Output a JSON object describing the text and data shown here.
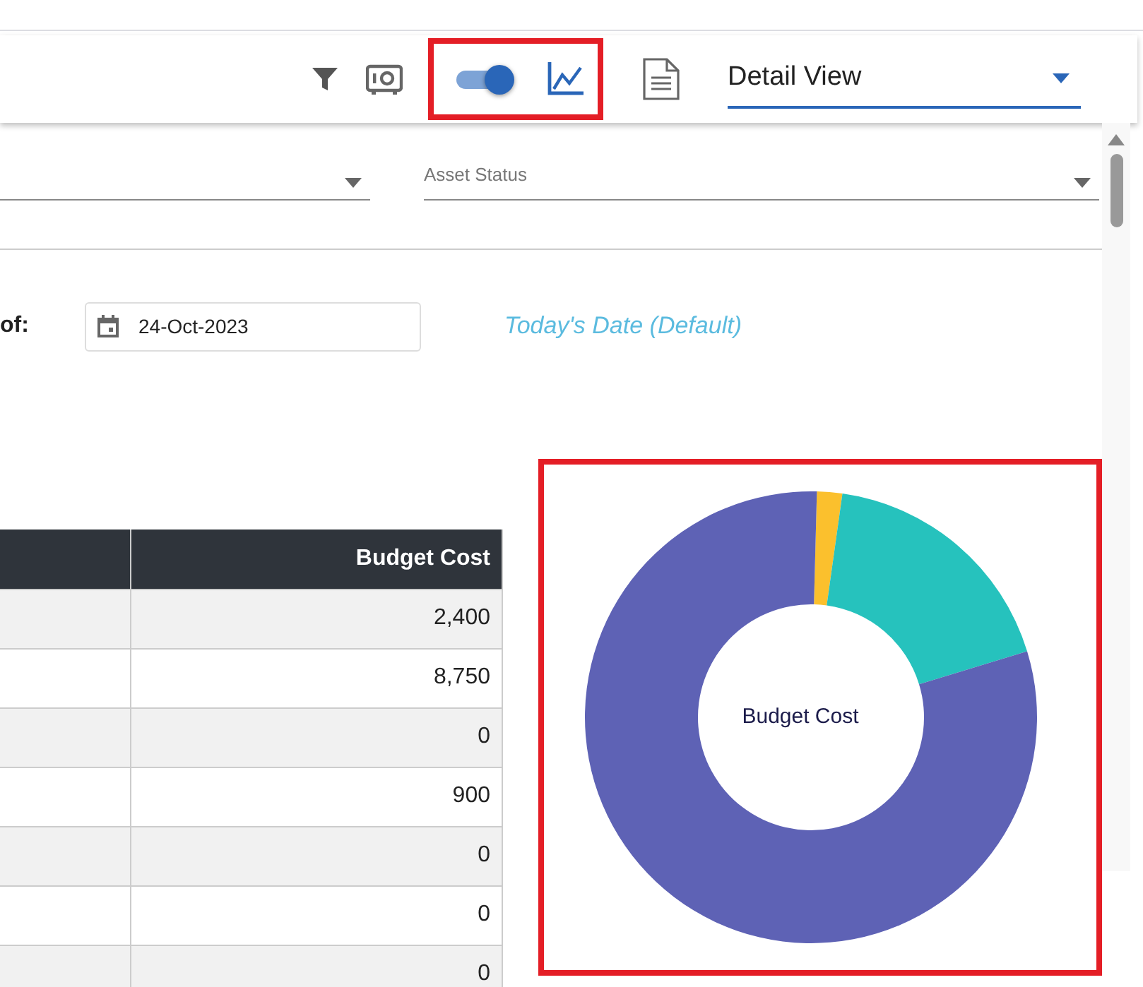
{
  "toolbar": {
    "chart_toggle": {
      "on": true
    },
    "highlighted": true,
    "view_select": {
      "value": "Detail View"
    }
  },
  "filters": [
    {
      "kind": "dropdown"
    },
    {
      "kind": "dropdown",
      "placeholder": "Asset Status"
    }
  ],
  "as_of": {
    "label": "of:",
    "date": "24-Oct-2023",
    "hint": "Today's Date (Default)"
  },
  "table": {
    "columns": [
      "Budget Cost"
    ],
    "rows": [
      {
        "budget_cost": "2,400"
      },
      {
        "budget_cost": "8,750"
      },
      {
        "budget_cost": "0"
      },
      {
        "budget_cost": "900"
      },
      {
        "budget_cost": "0"
      },
      {
        "budget_cost": "0"
      },
      {
        "budget_cost": "0"
      }
    ]
  },
  "chart_panel": {
    "highlighted": true,
    "center_label": "Budget Cost"
  }
}
